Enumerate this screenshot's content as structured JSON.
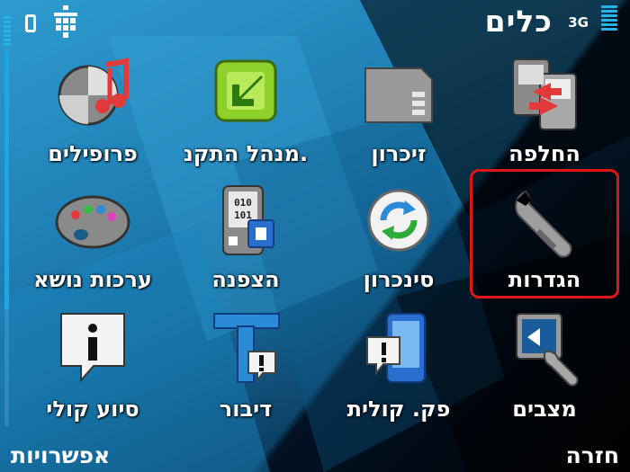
{
  "status_bar": {
    "title": "כלים",
    "network": "3G"
  },
  "menu": [
    {
      "label": "החלפה",
      "icon": "switch-icon"
    },
    {
      "label": "זיכרון",
      "icon": "memory-card-icon"
    },
    {
      "label": "מנהל התקנ.",
      "icon": "app-manager-icon"
    },
    {
      "label": "פרופילים",
      "icon": "profiles-icon"
    },
    {
      "label": "הגדרות",
      "icon": "settings-wrench-icon",
      "selected": true
    },
    {
      "label": "סינכרון",
      "icon": "sync-icon"
    },
    {
      "label": "הצפנה",
      "icon": "encryption-icon"
    },
    {
      "label": "ערכות נושא",
      "icon": "themes-palette-icon"
    },
    {
      "label": "מצבים",
      "icon": "modes-icon"
    },
    {
      "label": "פק. קולית",
      "icon": "voice-command-icon"
    },
    {
      "label": "דיבור",
      "icon": "speech-icon"
    },
    {
      "label": "סיוע קולי",
      "icon": "voice-aid-icon"
    }
  ],
  "softkeys": {
    "left": "אפשרויות",
    "right": "חזרה"
  },
  "colors": {
    "accent": "#25b3e8",
    "selection": "#e01616"
  }
}
